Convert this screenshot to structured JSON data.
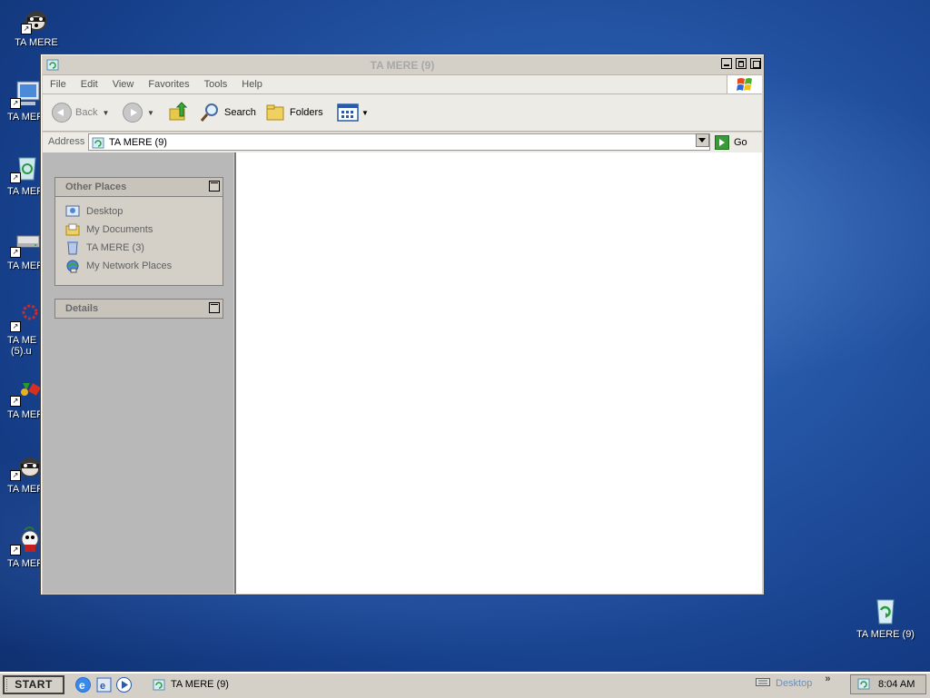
{
  "desktop": {
    "icons": [
      {
        "label": "TA MERE",
        "icon": "raccoon-icon"
      },
      {
        "label": "TA MER",
        "icon": "computer-icon"
      },
      {
        "label": "TA MER",
        "icon": "recycle-bin-icon"
      },
      {
        "label": "TA MER",
        "icon": "drive-icon"
      },
      {
        "label": "TA ME",
        "label2": "(5).u",
        "icon": "gear-icon"
      },
      {
        "label": "TA MER",
        "icon": "shapes-icon"
      },
      {
        "label": "TA MER",
        "icon": "raccoon-icon"
      },
      {
        "label": "TA MER",
        "icon": "mascot-icon"
      }
    ],
    "bin": {
      "label": "TA MERE (9)",
      "icon": "recycle-bin-icon"
    }
  },
  "window": {
    "title": "TA MERE (9)",
    "menu": [
      "File",
      "Edit",
      "View",
      "Favorites",
      "Tools",
      "Help"
    ],
    "toolbar": {
      "back": "Back",
      "search": "Search",
      "folders": "Folders"
    },
    "address": {
      "label": "Address",
      "value": "TA MERE (9)",
      "go": "Go"
    },
    "other_places": {
      "title": "Other Places",
      "links": [
        "Desktop",
        "My Documents",
        "TA MERE (3)",
        "My Network Places"
      ]
    },
    "details": {
      "title": "Details"
    }
  },
  "taskbar": {
    "start": "START",
    "task": "TA MERE (9)",
    "desktop_label": "Desktop",
    "more": "»",
    "clock": "8:04 AM"
  },
  "colors": {
    "desktop_blue": "#2556a6",
    "window_face": "#d4d0c8",
    "pane_gray": "#b8b8b8"
  }
}
